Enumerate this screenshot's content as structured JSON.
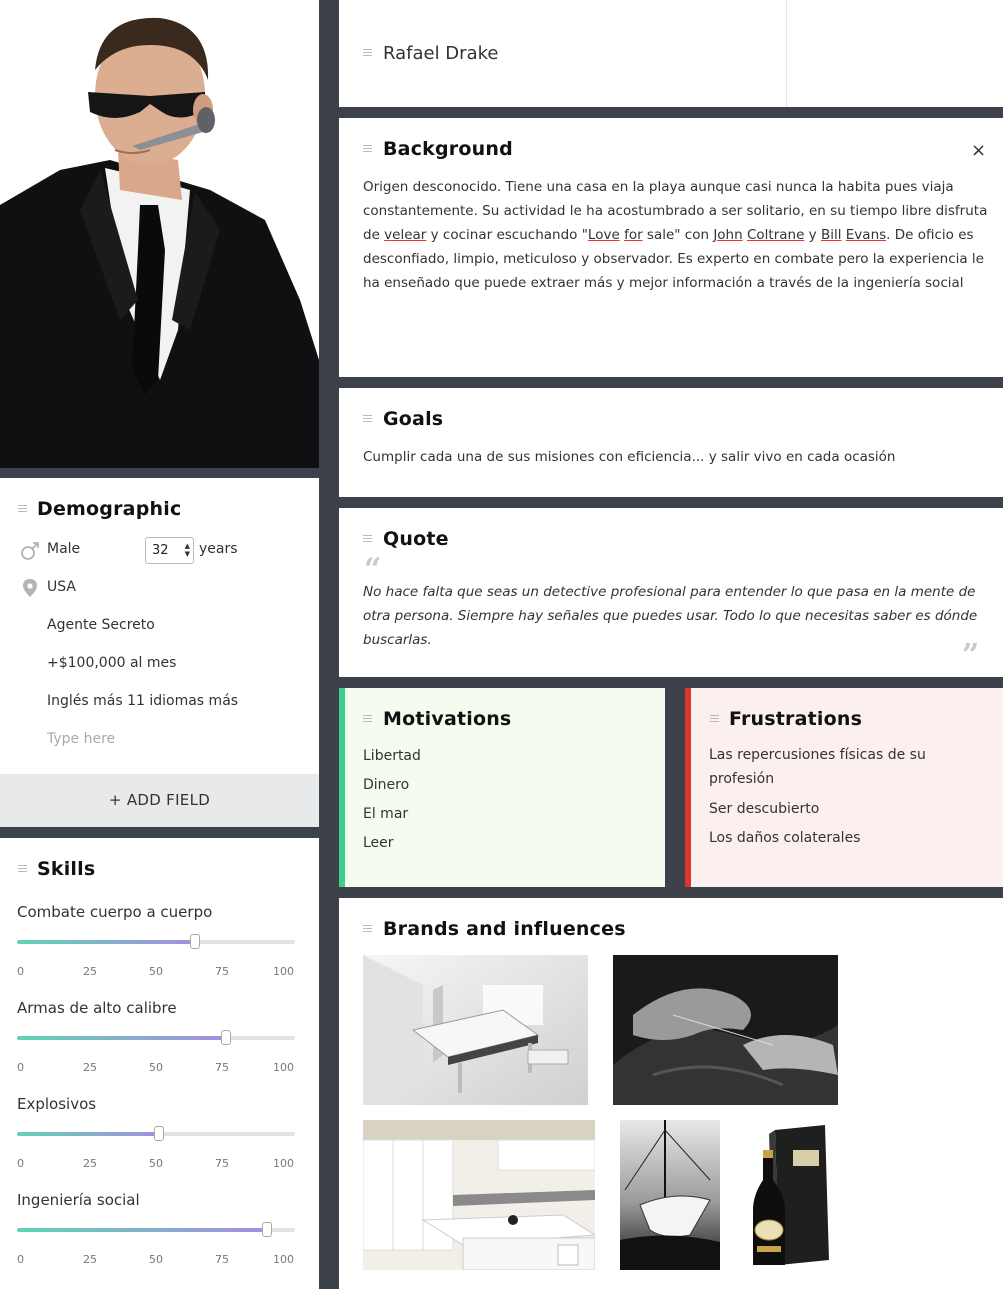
{
  "persona": {
    "name": "Rafael Drake"
  },
  "demographic": {
    "title": "Demographic",
    "gender": "Male",
    "age": "32",
    "age_unit": "years",
    "location": "USA",
    "occupation": "Agente Secreto",
    "income": "+$100,000 al mes",
    "languages": "Inglés más 11 idiomas más",
    "placeholder": "Type here",
    "add_field": "+ ADD FIELD"
  },
  "skills": {
    "title": "Skills",
    "ticks": [
      "0",
      "25",
      "50",
      "75",
      "100"
    ],
    "items": [
      {
        "name": "Combate cuerpo a cuerpo",
        "value": 64
      },
      {
        "name": "Armas de alto calibre",
        "value": 75
      },
      {
        "name": "Explosivos",
        "value": 51
      },
      {
        "name": "Ingeniería social",
        "value": 90
      }
    ]
  },
  "background": {
    "title": "Background",
    "close": "×",
    "t1": "Origen desconocido. Tiene una casa en la playa aunque casi nunca la habita pues viaja constantemente. Su actividad le ha acostumbrado a ser solitario, en su tiempo libre disfruta de ",
    "w_velear": "velear",
    "t2": "  y  cocinar escuchando \"",
    "w_love": "Love",
    "t3": " ",
    "w_for": "for",
    "t4": " sale\" con ",
    "w_john": "John",
    "t5": " ",
    "w_coltrane": "Coltrane",
    "t6": " y ",
    "w_bill": "Bill",
    "t7": " ",
    "w_evans": "Evans",
    "t8": ". De oficio es desconfiado, limpio, meticuloso y observador. Es experto en combate pero la experiencia le ha enseñado que puede extraer más y mejor información a través de la ingeniería social"
  },
  "goals": {
    "title": "Goals",
    "text": "Cumplir cada una de sus misiones con eficiencia... y salir vivo en cada ocasión"
  },
  "quote": {
    "title": "Quote",
    "text": " No hace falta que seas un detective profesional para entender lo que pasa en la mente de otra persona. Siempre hay señales que puedes usar. Todo lo que necesitas saber es dónde buscarlas."
  },
  "motivations": {
    "title": "Motivations",
    "items": [
      "Libertad",
      "Dinero",
      "El mar",
      "Leer"
    ]
  },
  "frustrations": {
    "title": "Frustrations",
    "items": [
      "Las repercusiones físicas de su profesión",
      "Ser descubierto",
      "Los daños colaterales"
    ]
  },
  "brands": {
    "title": "Brands and influences",
    "images": [
      "white-piano-room-image",
      "tailor-hands-image",
      "white-kitchen-image",
      "sailboat-image",
      "champagne-bottle-image"
    ]
  },
  "colors": {
    "motivation_accent": "#3ecf8e",
    "frustration_accent": "#e0352a",
    "slider_start": "#5fd4b3",
    "slider_end": "#a68ee0",
    "page_bg": "#3d4149"
  }
}
